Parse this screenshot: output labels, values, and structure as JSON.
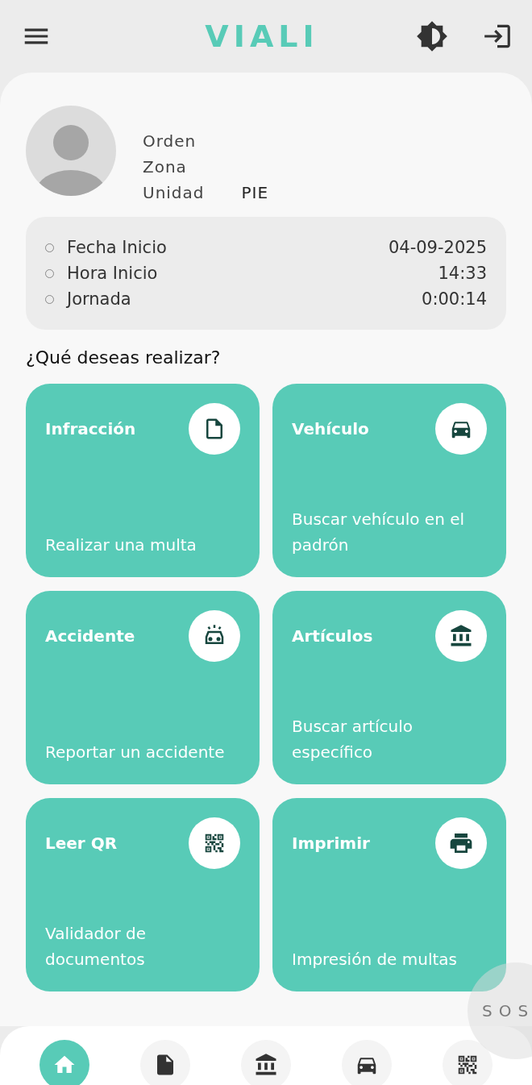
{
  "header": {
    "logo": "VIALI"
  },
  "profile": {
    "fields": [
      {
        "label": "Orden"
      },
      {
        "label": "Zona"
      },
      {
        "label": "Unidad",
        "value": "PIE"
      }
    ]
  },
  "shift": [
    {
      "label": "Fecha Inicio",
      "value": "04-09-2025"
    },
    {
      "label": "Hora Inicio",
      "value": "14:33"
    },
    {
      "label": "Jornada",
      "value": "0:00:14"
    }
  ],
  "question": "¿Qué deseas realizar?",
  "actions": [
    {
      "title": "Infracción",
      "subtitle": "Realizar una multa"
    },
    {
      "title": "Vehículo",
      "subtitle": "Buscar vehículo en el padrón"
    },
    {
      "title": "Accidente",
      "subtitle": "Reportar un accidente"
    },
    {
      "title": "Artículos",
      "subtitle": "Buscar artículo específico"
    },
    {
      "title": "Leer QR",
      "subtitle": "Validador de documentos"
    },
    {
      "title": "Imprimir",
      "subtitle": "Impresión de multas"
    }
  ],
  "sos": "SOS",
  "nav": [
    {
      "selected": true
    },
    {
      "selected": false
    },
    {
      "selected": false
    },
    {
      "selected": false
    },
    {
      "selected": false
    }
  ]
}
